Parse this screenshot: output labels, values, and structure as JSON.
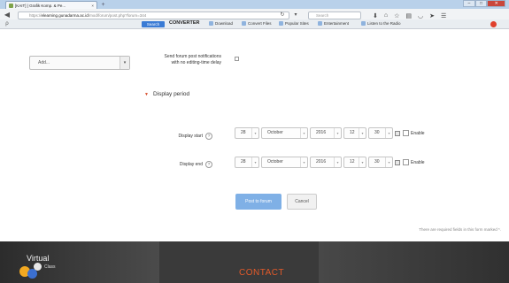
{
  "browser": {
    "tab_title": "[KAIT] | Grafik Komp. & Pe...",
    "tab_close": "×",
    "new_tab": "+",
    "url_prefix": "https://",
    "url_host": "elearning.gunadarma.ac.id",
    "url_path": "/mod/forum/post.php?forum=344",
    "search_placeholder": "Search",
    "window_buttons": [
      "–",
      "□",
      "✕"
    ]
  },
  "toolbar": {
    "search_button": "Search",
    "converter_label": "CONVERTER",
    "items": [
      "Download",
      "Convert Files",
      "Popular Sites",
      "Entertainment",
      "Listen to the Radio"
    ]
  },
  "form": {
    "add_select_value": "Add...",
    "notification_label_line1": "Send forum post notifications",
    "notification_label_line2": "with no editing-time delay",
    "section_title": "Display period",
    "display_start": {
      "label": "Display start",
      "day": "28",
      "month": "October",
      "year": "2016",
      "hour": "12",
      "minute": "30",
      "enable_label": "Enable"
    },
    "display_end": {
      "label": "Display end",
      "day": "28",
      "month": "October",
      "year": "2016",
      "hour": "12",
      "minute": "30",
      "enable_label": "Enable"
    },
    "save_button": "Post to forum",
    "cancel_button": "Cancel",
    "required_note": "There are required fields in this form marked *."
  },
  "footer": {
    "logo_text": "Virtual",
    "logo_sub": "Class",
    "contact_heading": "CONTACT"
  },
  "colors": {
    "accent_orange": "#d8502e",
    "save_button": "#7fb0e6",
    "footer_bg": "#3a3a3a"
  }
}
